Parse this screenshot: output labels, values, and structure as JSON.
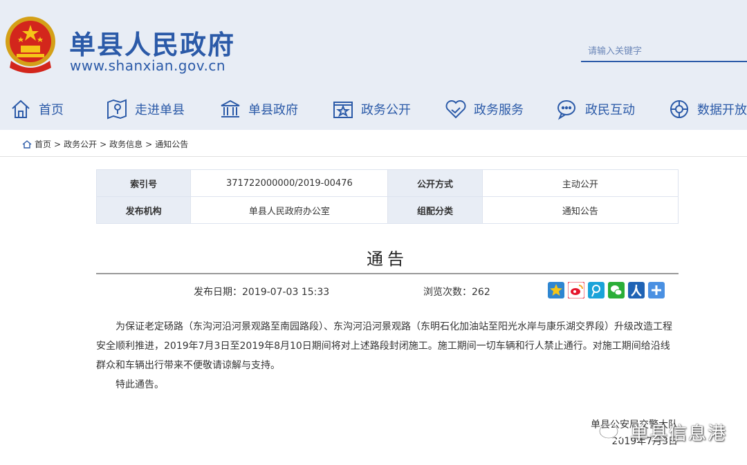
{
  "header": {
    "site_name": "单县人民政府",
    "site_url": "www.shanxian.gov.cn",
    "search_placeholder": "请输入关键字"
  },
  "nav": [
    {
      "label": "首页",
      "icon": "home-icon"
    },
    {
      "label": "走进单县",
      "icon": "map-pin-icon"
    },
    {
      "label": "单县政府",
      "icon": "government-building-icon"
    },
    {
      "label": "政务公开",
      "icon": "star-document-icon"
    },
    {
      "label": "政务服务",
      "icon": "handshake-heart-icon"
    },
    {
      "label": "政民互动",
      "icon": "chat-bubble-icon"
    },
    {
      "label": "数据开放",
      "icon": "data-globe-icon"
    }
  ],
  "breadcrumb": [
    "首页",
    "政务公开",
    "政务信息",
    "通知公告"
  ],
  "meta": {
    "index_label": "索引号",
    "index_value": "371722000000/2019-00476",
    "mode_label": "公开方式",
    "mode_value": "主动公开",
    "org_label": "发布机构",
    "org_value": "单县人民政府办公室",
    "category_label": "组配分类",
    "category_value": "通知公告"
  },
  "article": {
    "title": "通告",
    "pubdate": "发布日期：2019-07-03 15:33",
    "views": "浏览次数：262",
    "paragraph1": "为保证老定砀路（东沟河沿河景观路至南园路段）、东沟河沿河景观路（东明石化加油站至阳光水岸与康乐湖交界段）升级改造工程安全顺利推进，2019年7月3日至2019年8月10日期间将对上述路段封闭施工。施工期间一切车辆和行人禁止通行。对施工期间给沿线群众和车辆出行带来不便敬请谅解与支持。",
    "paragraph2": "特此通告。",
    "signature_org": "单县公安局交警大队",
    "signature_date": "2019年7月3日"
  },
  "share_icons": [
    "qzone-icon",
    "weibo-icon",
    "tencent-weibo-icon",
    "wechat-icon",
    "renren-icon",
    "more-share-icon"
  ],
  "watermark": "单县信息港",
  "colors": {
    "brand": "#2b5aa8",
    "header_bg": "#e8edf5"
  }
}
